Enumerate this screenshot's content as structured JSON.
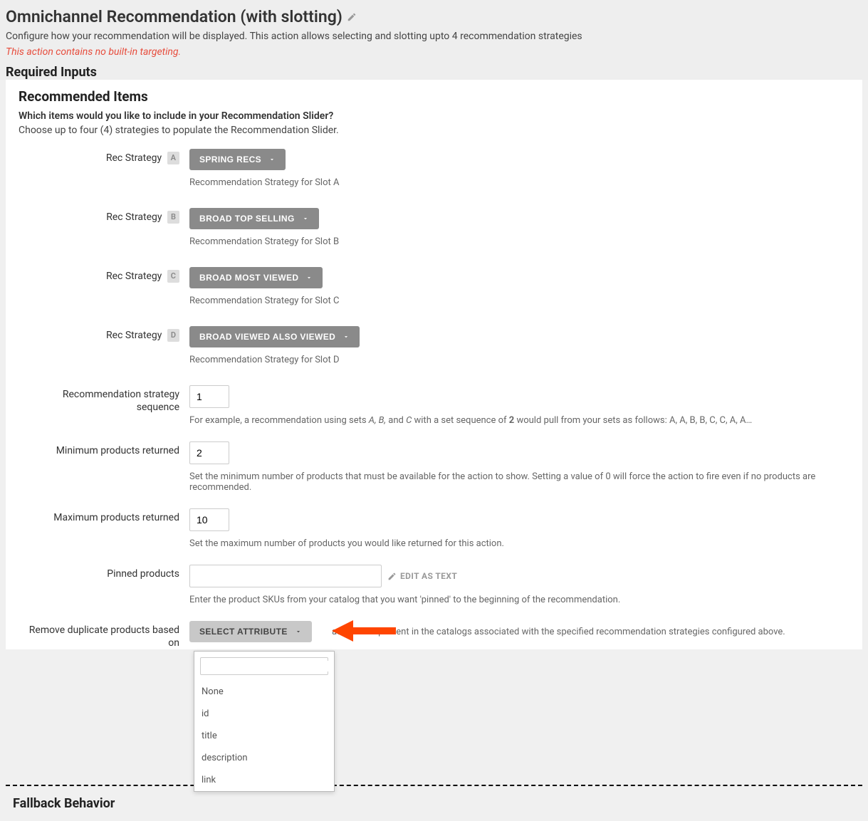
{
  "header": {
    "title": "Omnichannel Recommendation (with slotting)",
    "description": "Configure how your recommendation will be displayed. This action allows selecting and slotting upto 4 recommendation strategies",
    "warning": "This action contains no built-in targeting.",
    "required_inputs": "Required Inputs"
  },
  "panel": {
    "heading": "Recommended Items",
    "sub1": "Which items would you like to include in your Recommendation Slider?",
    "sub2": "Choose up to four (4) strategies to populate the Recommendation Slider."
  },
  "slots": [
    {
      "label": "Rec Strategy",
      "badge": "A",
      "value": "SPRING RECS",
      "help": "Recommendation Strategy for Slot A"
    },
    {
      "label": "Rec Strategy",
      "badge": "B",
      "value": "BROAD TOP SELLING",
      "help": "Recommendation Strategy for Slot B"
    },
    {
      "label": "Rec Strategy",
      "badge": "C",
      "value": "BROAD MOST VIEWED",
      "help": "Recommendation Strategy for Slot C"
    },
    {
      "label": "Rec Strategy",
      "badge": "D",
      "value": "BROAD VIEWED ALSO VIEWED",
      "help": "Recommendation Strategy for Slot D"
    }
  ],
  "sequence": {
    "label": "Recommendation strategy sequence",
    "value": "1",
    "help_pre": "For example, a recommendation using sets ",
    "help_sets": "A, B,",
    "help_mid": " and ",
    "help_c": "C",
    "help_mid2": " with a set sequence of ",
    "help_num": "2",
    "help_post": " would pull from your sets as follows: A, A, B, B, C, C, A, A…"
  },
  "min": {
    "label": "Minimum products returned",
    "value": "2",
    "help": "Set the minimum number of products that must be available for the action to show. Setting a value of 0 will force the action to fire even if no products are recommended."
  },
  "max": {
    "label": "Maximum products returned",
    "value": "10",
    "help": "Set the maximum number of products you would like returned for this action."
  },
  "pinned": {
    "label": "Pinned products",
    "value": "",
    "edit_as_text": "EDIT AS TEXT",
    "help": "Enter the product SKUs from your catalog that you want 'pinned' to the beginning of the recommendation."
  },
  "dedupe": {
    "label": "Remove duplicate products based on",
    "btn": "SELECT ATTRIBUTE",
    "help": "attribute is present in the catalogs associated with the specified recommendation strategies configured above.",
    "options": [
      "None",
      "id",
      "title",
      "description",
      "link"
    ]
  },
  "fallback": {
    "title": "Fallback Behavior"
  },
  "colors": {
    "warning": "#e74c3c",
    "btn_gray": "#8a8a8a",
    "arrow": "#ff4500"
  }
}
